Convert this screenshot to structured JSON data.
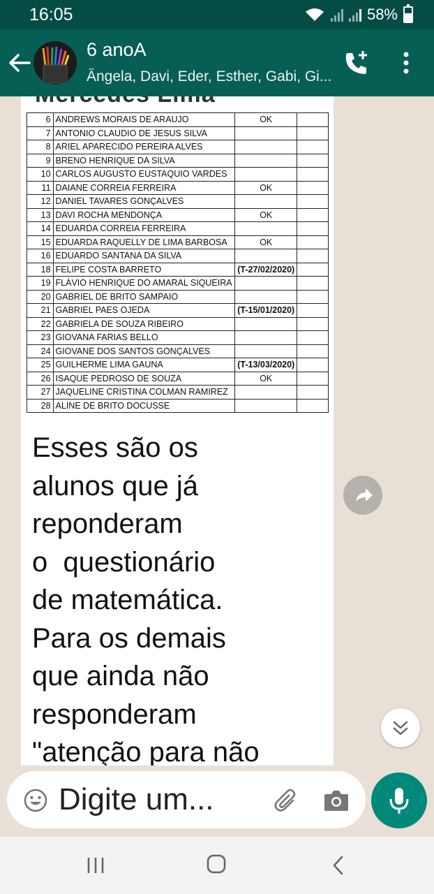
{
  "status_bar": {
    "time": "16:05",
    "battery": "58%"
  },
  "header": {
    "title": "6 anoA",
    "subtitle": "Ângela, Davi, Eder, Esther, Gabi, Gi..."
  },
  "document": {
    "heading": "Mercedes Lima",
    "rows": [
      {
        "num": "6",
        "name": "ANDREWS MORAIS DE ARAUJO",
        "status": "OK"
      },
      {
        "num": "7",
        "name": "ANTONIO CLAUDIO DE JESUS SILVA",
        "status": ""
      },
      {
        "num": "8",
        "name": "ARIEL APARECIDO PEREIRA ALVES",
        "status": ""
      },
      {
        "num": "9",
        "name": "BRENO HENRIQUE DA SILVA",
        "status": ""
      },
      {
        "num": "10",
        "name": "CARLOS AUGUSTO EUSTAQUIO VARDES",
        "status": ""
      },
      {
        "num": "11",
        "name": "DAIANE CORREIA FERREIRA",
        "status": "OK"
      },
      {
        "num": "12",
        "name": "DANIEL TAVARES GONÇALVES",
        "status": ""
      },
      {
        "num": "13",
        "name": "DAVI ROCHA MENDONÇA",
        "status": "OK"
      },
      {
        "num": "14",
        "name": "EDUARDA CORREIA FERREIRA",
        "status": ""
      },
      {
        "num": "15",
        "name": "EDUARDA RAQUELLY DE LIMA BARBOSA",
        "status": "OK"
      },
      {
        "num": "16",
        "name": "EDUARDO SANTANA DA SILVA",
        "status": ""
      },
      {
        "num": "18",
        "name": "FELIPE COSTA BARRETO",
        "status": "(T-27/02/2020)"
      },
      {
        "num": "19",
        "name": "FLÁVIO HENRIQUE DO AMARAL SIQUEIRA",
        "status": ""
      },
      {
        "num": "20",
        "name": "GABRIEL DE BRITO SAMPAIO",
        "status": ""
      },
      {
        "num": "21",
        "name": "GABRIEL PAES OJEDA",
        "status": "(T-15/01/2020)"
      },
      {
        "num": "22",
        "name": "GABRIELA DE SOUZA RIBEIRO",
        "status": ""
      },
      {
        "num": "23",
        "name": "GIOVANA FARIAS BELLO",
        "status": ""
      },
      {
        "num": "24",
        "name": "GIOVANE DOS SANTOS GONÇALVES",
        "status": ""
      },
      {
        "num": "25",
        "name": "GUILHERME LIMA GAUNA",
        "status": "(T-13/03/2020)"
      },
      {
        "num": "26",
        "name": "ISAQUE PEDROSO DE SOUZA",
        "status": "OK"
      },
      {
        "num": "27",
        "name": "JAQUELINE CRISTINA COLMAN RAMIREZ",
        "status": ""
      },
      {
        "num": "28",
        "name": "ALINE DE BRITO DOCUSSE",
        "status": ""
      }
    ]
  },
  "message": {
    "lines": [
      "Esses são os",
      "alunos que já",
      "reponderam",
      "o  questionário",
      "de matemática.",
      "Para os demais",
      "que ainda não",
      "responderam",
      "\"atenção para não"
    ]
  },
  "input": {
    "placeholder": "Digite um..."
  },
  "icons": {
    "back": "arrow-left-icon",
    "call": "add-call-icon",
    "menu": "more-vert-icon",
    "forward": "forward-icon",
    "scroll": "double-chevron-down-icon",
    "emoji": "emoji-icon",
    "attach": "paperclip-icon",
    "camera": "camera-icon",
    "mic": "mic-icon"
  },
  "colors": {
    "header": "#075e54",
    "status_bar": "#054d44",
    "accent": "#00897b",
    "chat_background": "#e8e0d6"
  }
}
